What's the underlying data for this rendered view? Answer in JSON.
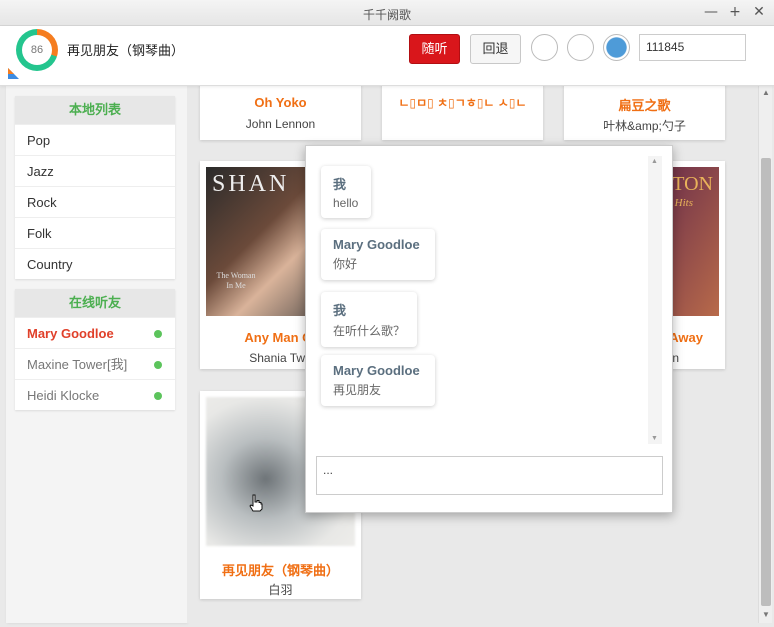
{
  "window": {
    "title": "千千阙歌"
  },
  "window_controls": {
    "minimize": "—",
    "maximize": "+",
    "close": "✕"
  },
  "header": {
    "progress_value": "86",
    "now_playing": "再见朋友（钢琴曲）",
    "random_label": "随听",
    "back_label": "回退",
    "code_value": "111845"
  },
  "sidebar": {
    "local_title": "本地列表",
    "local_items": [
      "Pop",
      "Jazz",
      "Rock",
      "Folk",
      "Country"
    ],
    "online_title": "在线听友",
    "friends": [
      "Mary Goodloe",
      "Maxine Tower[我]",
      "Heidi Klocke"
    ]
  },
  "cards": [
    {
      "title": "Oh Yoko",
      "artist": "John Lennon"
    },
    {
      "title": "ㄴ▯ㅁ▯ ㅊ▯ㄱㅎ▯ㄴ ㅅ▯ㄴ",
      "artist": ""
    },
    {
      "title": "扁豆之歌",
      "artist": "叶林&amp;勺子"
    },
    {
      "title": "Any Man Of",
      "artist": "Shania Twa",
      "cover_text": "SHAN",
      "cover_sub": "The Woman In Me"
    },
    {
      "title": "Away",
      "artist": "n",
      "cover_text": "TON",
      "cover_sub": "Hits"
    },
    {
      "title": "再见朋友（钢琴曲）",
      "artist": "白羽"
    }
  ],
  "chat": {
    "messages": [
      {
        "who": "我",
        "text": "hello"
      },
      {
        "who": "Mary Goodloe",
        "text": "你好"
      },
      {
        "who": "我",
        "text": "在听什么歌？"
      },
      {
        "who": "Mary Goodloe",
        "text": "再见朋友"
      }
    ],
    "input_value": "..."
  },
  "colors": {
    "accent_red": "#d9161b",
    "title_orange": "#f06f14",
    "list_header_green": "#4caf50",
    "online_dot": "#5cc45c"
  }
}
